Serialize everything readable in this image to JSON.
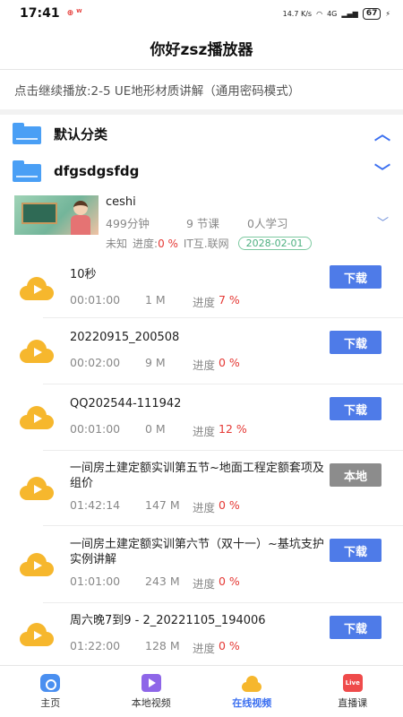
{
  "status_bar": {
    "time": "17:41",
    "app_indicators": "⊕ ᵂ",
    "net_speed": "14.7 K/s",
    "signal": "4G",
    "battery": "67"
  },
  "header": {
    "title": "你好zsz播放器"
  },
  "continue": {
    "text": "点击继续播放:2-5 UE地形材质讲解（通用密码模式）"
  },
  "categories": [
    {
      "label": "默认分类",
      "expanded": false,
      "chevron": "︿"
    },
    {
      "label": "dfgsdgsfdg",
      "expanded": true,
      "chevron": "﹀"
    }
  ],
  "course": {
    "name": "ceshi",
    "duration": "499分钟",
    "lessons": "9 节课",
    "learners": "0人学习",
    "status": "未知",
    "progress_label": "进度:",
    "progress_value": "0 %",
    "source": "IT互.联网",
    "date": "2028-02-01",
    "chevron": "﹀"
  },
  "videos": [
    {
      "title": "10秒",
      "duration": "00:01:00",
      "size": "1 M",
      "progress_label": "进度",
      "progress": "7 %",
      "action": "下载",
      "action_type": "download"
    },
    {
      "title": "20220915_200508",
      "duration": "00:02:00",
      "size": "9 M",
      "progress_label": "进度",
      "progress": "0 %",
      "action": "下载",
      "action_type": "download"
    },
    {
      "title": "QQ202544-111942",
      "duration": "00:01:00",
      "size": "0 M",
      "progress_label": "进度",
      "progress": "12 %",
      "action": "下载",
      "action_type": "download"
    },
    {
      "title": "一间房土建定额实训第五节~地面工程定额套项及组价",
      "duration": "01:42:14",
      "size": "147 M",
      "progress_label": "进度",
      "progress": "0 %",
      "action": "本地",
      "action_type": "local"
    },
    {
      "title": "一间房土建定额实训第六节（双十一）~基坑支护实例讲解",
      "duration": "01:01:00",
      "size": "243 M",
      "progress_label": "进度",
      "progress": "0 %",
      "action": "下载",
      "action_type": "download"
    },
    {
      "title": "周六晚7到9 - 2_20221105_194006",
      "duration": "01:22:00",
      "size": "128 M",
      "progress_label": "进度",
      "progress": "0 %",
      "action": "下载",
      "action_type": "download"
    }
  ],
  "bottom_nav": [
    {
      "label": "主页",
      "icon": "home-icon",
      "active": false
    },
    {
      "label": "本地视频",
      "icon": "local-video-icon",
      "active": false
    },
    {
      "label": "在线视频",
      "icon": "online-video-icon",
      "active": true
    },
    {
      "label": "直播课",
      "icon": "live-icon",
      "active": false,
      "badge": "Live"
    }
  ],
  "colors": {
    "accent": "#3b6ff0",
    "download": "#4e7be8",
    "local": "#8c8c8c",
    "progress_red": "#e53935",
    "cloud": "#f6b72d",
    "folder": "#4a9ff5"
  }
}
